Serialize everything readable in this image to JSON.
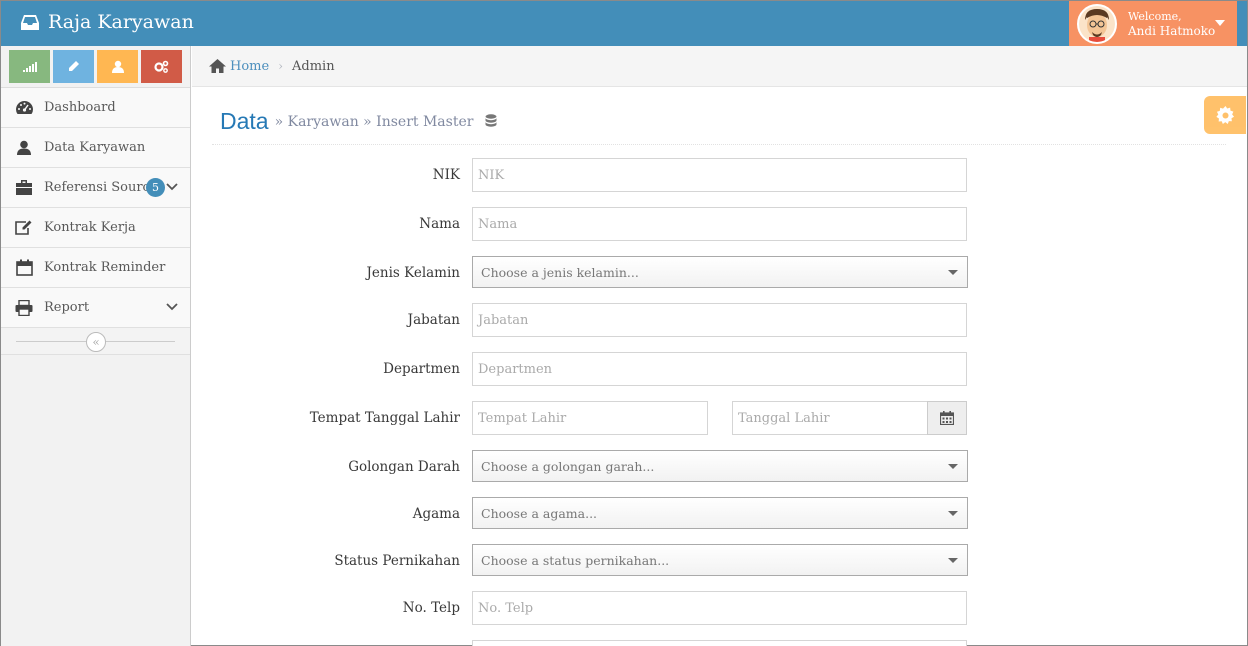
{
  "brand": {
    "title": "Raja Karyawan",
    "icon": "inbox-icon"
  },
  "user": {
    "welcome": "Welcome,",
    "name": "Andi Hatmoko"
  },
  "sidebar": {
    "shortcuts": [
      {
        "icon": "signal-icon",
        "color": "#87b87f"
      },
      {
        "icon": "pencil-icon",
        "color": "#6fb3e0"
      },
      {
        "icon": "user-icon",
        "color": "#ffb752"
      },
      {
        "icon": "cogs-icon",
        "color": "#d15b47"
      }
    ],
    "items": [
      {
        "label": "Dashboard",
        "icon": "tachometer-icon"
      },
      {
        "label": "Data Karyawan",
        "icon": "user-icon"
      },
      {
        "label": "Referensi Source",
        "icon": "briefcase-icon",
        "badge": "5"
      },
      {
        "label": "Kontrak Kerja",
        "icon": "edit-icon"
      },
      {
        "label": "Kontrak Reminder",
        "icon": "calendar-icon"
      },
      {
        "label": "Report",
        "icon": "print-icon"
      }
    ]
  },
  "breadcrumb": {
    "home": "Home",
    "current": "Admin"
  },
  "header": {
    "title": "Data",
    "subtitle": "» Karyawan » Insert Master"
  },
  "form": {
    "nik": {
      "label": "NIK",
      "placeholder": "NIK"
    },
    "nama": {
      "label": "Nama",
      "placeholder": "Nama"
    },
    "jenis_kelamin": {
      "label": "Jenis Kelamin",
      "placeholder": "Choose a jenis kelamin..."
    },
    "jabatan": {
      "label": "Jabatan",
      "placeholder": "Jabatan"
    },
    "departmen": {
      "label": "Departmen",
      "placeholder": "Departmen"
    },
    "ttl": {
      "label": "Tempat Tanggal Lahir",
      "tempat_placeholder": "Tempat Lahir",
      "tanggal_placeholder": "Tanggal Lahir"
    },
    "golongan_darah": {
      "label": "Golongan Darah",
      "placeholder": "Choose a golongan garah..."
    },
    "agama": {
      "label": "Agama",
      "placeholder": "Choose a agama..."
    },
    "status_pernikahan": {
      "label": "Status Pernikahan",
      "placeholder": "Choose a status pernikahan..."
    },
    "no_telp": {
      "label": "No. Telp",
      "placeholder": "No. Telp"
    }
  }
}
